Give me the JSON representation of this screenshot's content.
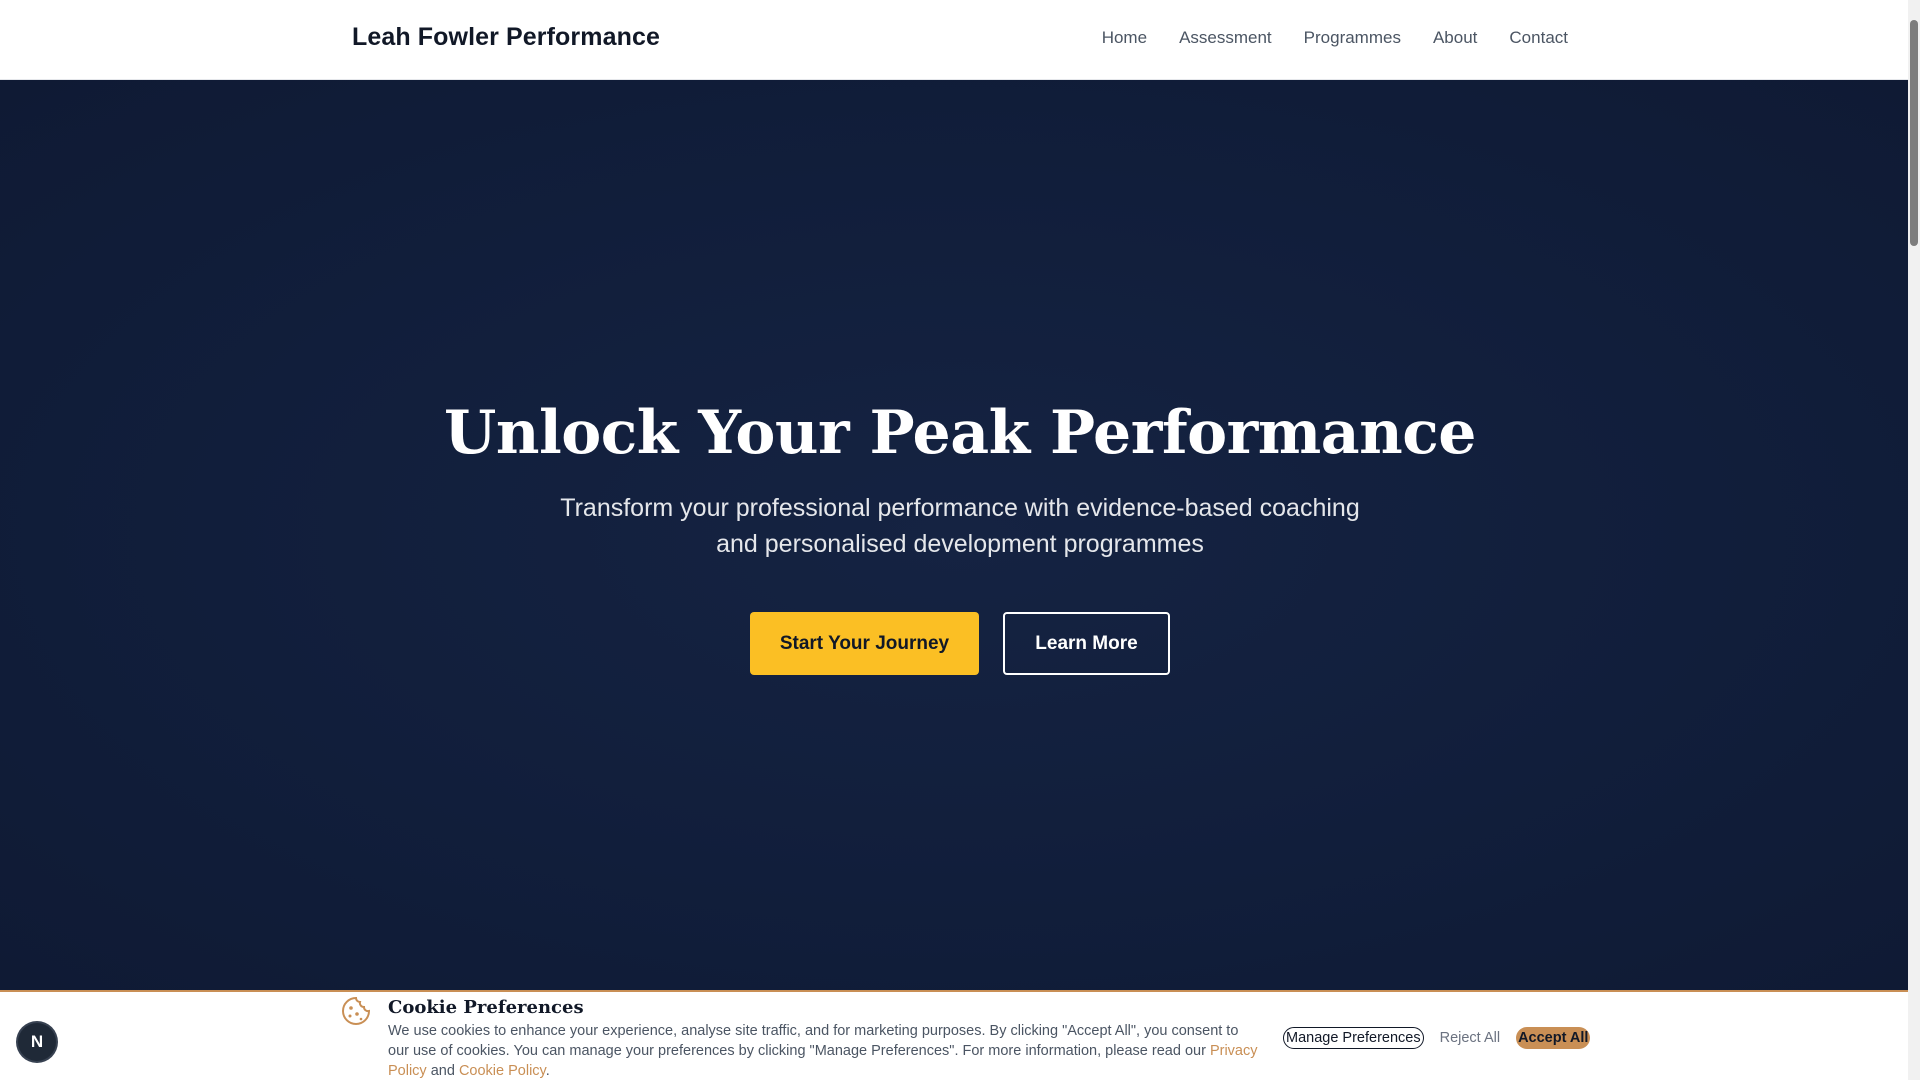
{
  "header": {
    "brand": "Leah Fowler Performance",
    "nav": [
      "Home",
      "Assessment",
      "Programmes",
      "About",
      "Contact"
    ]
  },
  "hero": {
    "title": "Unlock Your Peak Performance",
    "subtitle": "Transform your professional performance with evidence-based coaching and personalised development programmes",
    "primary_cta": "Start Your Journey",
    "secondary_cta": "Learn More"
  },
  "cookie": {
    "title": "Cookie Preferences",
    "text": "We use cookies to enhance your experience, analyse site traffic, and for marketing purposes. By clicking \"Accept All\", you consent to our use of cookies. You can manage your preferences by clicking \"Manage Preferences\". For more information, please read our",
    "privacy_link": "Privacy Policy",
    "and": "and",
    "cookie_link": "Cookie Policy",
    "period": ".",
    "manage_label": "Manage Preferences",
    "reject_label": "Reject All",
    "accept_label": "Accept All",
    "icon": "cookie-icon"
  },
  "badge": {
    "label": "N"
  },
  "colors": {
    "hero_bg": "#111e3b",
    "primary_cta": "#fbbf24",
    "cookie_accent": "#c98f55"
  }
}
